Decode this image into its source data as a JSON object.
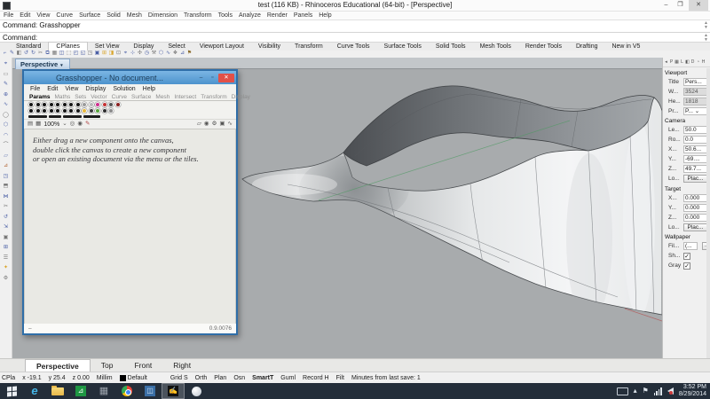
{
  "window": {
    "title": "test (116 KB) - Rhinoceros Educational (64-bit) - [Perspective]",
    "minimize_label": "–",
    "restore_label": "❐",
    "close_label": "✕"
  },
  "menubar": {
    "items": [
      "File",
      "Edit",
      "View",
      "Curve",
      "Surface",
      "Solid",
      "Mesh",
      "Dimension",
      "Transform",
      "Tools",
      "Analyze",
      "Render",
      "Panels",
      "Help"
    ]
  },
  "command": {
    "history": "Command: Grasshopper",
    "prompt": "Command:"
  },
  "toolbar_tabs": {
    "active": "CPlanes",
    "tabs": [
      "Standard",
      "CPlanes",
      "Set View",
      "Display",
      "Select",
      "Viewport Layout",
      "Visibility",
      "Transform",
      "Curve Tools",
      "Surface Tools",
      "Solid Tools",
      "Mesh Tools",
      "Render Tools",
      "Drafting",
      "New in V5"
    ]
  },
  "toolbar_icons": [
    {
      "g": "⌐",
      "c": "#4a5fa5"
    },
    {
      "g": "✎",
      "c": "#4a5fa5"
    },
    {
      "g": "◧",
      "c": "#777777"
    },
    {
      "g": "↺",
      "c": "#4a5fa5"
    },
    {
      "g": "↻",
      "c": "#4a5fa5"
    },
    {
      "g": "✂",
      "c": "#777777"
    },
    {
      "g": "⧉",
      "c": "#4a5fa5"
    },
    {
      "g": "▦",
      "c": "#777777"
    },
    {
      "g": "◫",
      "c": "#4a5fa5"
    },
    {
      "g": "⬚",
      "c": "#777777"
    },
    {
      "g": "◰",
      "c": "#4a5fa5"
    },
    {
      "g": "◱",
      "c": "#4a5fa5"
    },
    {
      "g": "◳",
      "c": "#777777"
    },
    {
      "g": "▣",
      "c": "#4a5fa5"
    },
    {
      "g": "⊞",
      "c": "#d9a62e"
    },
    {
      "g": "◨",
      "c": "#d9a62e"
    },
    {
      "g": "⊡",
      "c": "#777777"
    },
    {
      "g": "⌖",
      "c": "#4a5fa5"
    },
    {
      "g": "⊹",
      "c": "#4a5fa5"
    },
    {
      "g": "✣",
      "c": "#777777"
    },
    {
      "g": "◷",
      "c": "#4a5fa5"
    },
    {
      "g": "⚒",
      "c": "#777777"
    },
    {
      "g": "⬡",
      "c": "#4a5fa5"
    },
    {
      "g": "∿",
      "c": "#4a5fa5"
    },
    {
      "g": "❖",
      "c": "#777777"
    },
    {
      "g": "⊿",
      "c": "#4a5fa5"
    },
    {
      "g": "⚑",
      "c": "#8a6a2a"
    }
  ],
  "left_toolbar_icons": [
    {
      "g": "⌖",
      "c": "#4a5fa5"
    },
    {
      "g": "▭",
      "c": "#777777"
    },
    {
      "g": "✎",
      "c": "#4a5fa5"
    },
    {
      "g": "⊕",
      "c": "#4a5fa5"
    },
    {
      "g": "∿",
      "c": "#4a5fa5"
    },
    {
      "g": "◯",
      "c": "#777777"
    },
    {
      "g": "⬡",
      "c": "#4a5fa5"
    },
    {
      "g": "◠",
      "c": "#4a5fa5"
    },
    {
      "g": "⌒",
      "c": "#777777"
    },
    {
      "g": "▱",
      "c": "#4a5fa5"
    },
    {
      "g": "⊿",
      "c": "#b06030"
    },
    {
      "g": "◳",
      "c": "#4a5fa5"
    },
    {
      "g": "⬒",
      "c": "#777777"
    },
    {
      "g": "⋈",
      "c": "#4a5fa5"
    },
    {
      "g": "✂",
      "c": "#777777"
    },
    {
      "g": "↺",
      "c": "#4a5fa5"
    },
    {
      "g": "⇲",
      "c": "#4a5fa5"
    },
    {
      "g": "▣",
      "c": "#777777"
    },
    {
      "g": "⊞",
      "c": "#4a5fa5"
    },
    {
      "g": "☰",
      "c": "#777777"
    },
    {
      "g": "✦",
      "c": "#d9a62e"
    },
    {
      "g": "⚙",
      "c": "#777777"
    }
  ],
  "viewport": {
    "label": "Perspective",
    "caret": "▾",
    "bg": "#a8abad"
  },
  "grasshopper": {
    "title": "Grasshopper - No document...",
    "minimize_label": "–",
    "maximize_label": "▫",
    "close_label": "✕",
    "menus": [
      "File",
      "Edit",
      "View",
      "Display",
      "Solution",
      "Help"
    ],
    "tabs": [
      "Params",
      "Maths",
      "Sets",
      "Vector",
      "Curve",
      "Surface",
      "Mesh",
      "Intersect",
      "Transform",
      "Display"
    ],
    "active_tab": "Params",
    "zoom": "100%",
    "zoom_caret": "⌄",
    "canvas_message": [
      "Either drag a new component onto the canvas,",
      "double click the canvas to create a new component",
      "or open an existing document via the menu or the tiles."
    ],
    "version": "0.9.0076",
    "status_left": "–",
    "palette_row1": [
      "#141414",
      "#141414",
      "#141414",
      "#141414",
      "#141414",
      "#141414",
      "#141414",
      "#141414",
      "#9a9a9a",
      "#b8b8b8",
      "#cf2f8e",
      "#c43333",
      "#555555",
      "#8a1f1f"
    ],
    "palette_row2": [
      "#141414",
      "#141414",
      "#141414",
      "#141414",
      "#141414",
      "#141414",
      "#141414",
      "#141414",
      "#e7b73a",
      "#3c3c3c",
      "#57a33b",
      "#2d2d2d",
      "#8a8a8a"
    ],
    "group_bars": [
      {
        "x": 5,
        "w": 21
      },
      {
        "x": 28,
        "w": 14
      },
      {
        "x": 44,
        "w": 21
      },
      {
        "x": 67,
        "w": 19
      }
    ]
  },
  "properties_panel": {
    "tab_icons": [
      "◂",
      "P",
      "▦",
      "L",
      "◧",
      "D",
      "◔",
      "H"
    ],
    "sections": [
      {
        "header": "Viewport",
        "rows": [
          {
            "label": "Title",
            "value": "Pers...",
            "type": "text"
          },
          {
            "label": "W...",
            "value": "3524",
            "type": "disabled"
          },
          {
            "label": "He...",
            "value": "1818",
            "type": "disabled"
          },
          {
            "label": "Pr...",
            "value": "P...",
            "type": "select"
          }
        ]
      },
      {
        "header": "Camera",
        "rows": [
          {
            "label": "Le...",
            "value": "50.0",
            "type": "box"
          },
          {
            "label": "Ro...",
            "value": "0.0",
            "type": "box"
          },
          {
            "label": "X...",
            "value": "50.6...",
            "type": "box"
          },
          {
            "label": "Y...",
            "value": "-69....",
            "type": "box"
          },
          {
            "label": "Z...",
            "value": "49.7...",
            "type": "box"
          },
          {
            "label": "Lo...",
            "value": "Plac...",
            "type": "button"
          }
        ]
      },
      {
        "header": "Target",
        "rows": [
          {
            "label": "X...",
            "value": "0.000",
            "type": "box"
          },
          {
            "label": "Y...",
            "value": "0.000",
            "type": "box"
          },
          {
            "label": "Z...",
            "value": "0.000",
            "type": "box"
          },
          {
            "label": "Lo...",
            "value": "Plac...",
            "type": "button"
          }
        ]
      },
      {
        "header": "Wallpaper",
        "rows": [
          {
            "label": "Fil...",
            "value": "(...",
            "type": "browse"
          },
          {
            "label": "Sh...",
            "type": "checkbox",
            "checked": true
          },
          {
            "label": "Gray",
            "type": "checkbox",
            "checked": true
          }
        ]
      }
    ]
  },
  "viewport_tabs": {
    "active": "Perspective",
    "tabs": [
      "Perspective",
      "Top",
      "Front",
      "Right"
    ]
  },
  "status_bar": {
    "segments": [
      {
        "text": "CPla"
      },
      {
        "text": "x -19.1"
      },
      {
        "text": "y 25.4"
      },
      {
        "text": "z 0.00"
      },
      {
        "text": "Millim"
      },
      {
        "text": "Default",
        "swatch": "#000000"
      },
      {
        "text": "Grid S",
        "gap": true
      },
      {
        "text": "Orth"
      },
      {
        "text": "Plan"
      },
      {
        "text": "Osn"
      },
      {
        "text": "SmartT",
        "bold": true
      },
      {
        "text": "Guml"
      },
      {
        "text": "Record H"
      },
      {
        "text": "Filt"
      },
      {
        "text": "Minutes from last save: 1"
      }
    ]
  },
  "taskbar": {
    "apps": [
      {
        "kind": "start",
        "name": "start-button"
      },
      {
        "kind": "ie",
        "name": "internet-explorer-icon",
        "glyph": "e"
      },
      {
        "kind": "folder",
        "name": "file-explorer-icon"
      },
      {
        "kind": "green",
        "name": "app-icon-green",
        "glyph": "⊿"
      },
      {
        "kind": "gray",
        "name": "app-icon-gray",
        "glyph": "▦"
      },
      {
        "kind": "chrome",
        "name": "chrome-icon"
      },
      {
        "kind": "blue",
        "name": "control-panel-icon",
        "glyph": "◫"
      },
      {
        "kind": "rhino",
        "name": "rhino-app-icon",
        "glyph": "✍",
        "active": true
      },
      {
        "kind": "ball",
        "name": "app-icon-ball"
      }
    ],
    "tray_chevron": "▴",
    "flag_glyph": "⚑",
    "time": "3:52 PM",
    "date": "8/29/2014"
  },
  "colors": {
    "viewport_bg": "#a8abad",
    "gh_titlebar": "#5ea7dc",
    "gh_close": "#e25048",
    "construction_green": "#4f9a62",
    "construction_red": "#b05858",
    "taskbar": "#242e3a"
  }
}
